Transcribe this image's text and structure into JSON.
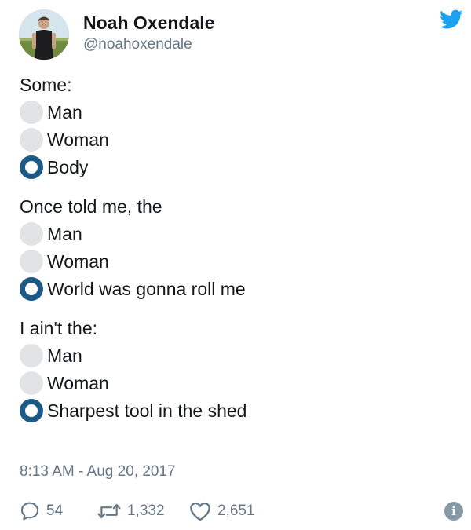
{
  "author": {
    "display_name": "Noah Oxendale",
    "handle": "@noahoxendale"
  },
  "icons": {
    "avatar": "profile-photo",
    "brand": "twitter-bird-icon",
    "reply": "speech-bubble-icon",
    "retweet": "retweet-arrows-icon",
    "like": "heart-icon",
    "info": "info-icon"
  },
  "colors": {
    "brand": "#1da1f2",
    "radio_checked": "#1b5a87",
    "radio_unchecked": "#e1e3e5",
    "secondary_text": "#657786"
  },
  "tweet": {
    "stanzas": [
      {
        "intro": "Some:",
        "options": [
          {
            "label": "Man",
            "checked": false
          },
          {
            "label": "Woman",
            "checked": false
          },
          {
            "label": "Body",
            "checked": true
          }
        ]
      },
      {
        "intro": "Once told me, the",
        "options": [
          {
            "label": "Man",
            "checked": false
          },
          {
            "label": "Woman",
            "checked": false
          },
          {
            "label": "World was gonna roll me",
            "checked": true
          }
        ]
      },
      {
        "intro": "I ain't the:",
        "options": [
          {
            "label": "Man",
            "checked": false
          },
          {
            "label": "Woman",
            "checked": false
          },
          {
            "label": "Sharpest tool in the shed",
            "checked": true
          }
        ]
      }
    ],
    "timestamp": "8:13 AM - Aug 20, 2017"
  },
  "stats": {
    "replies": "54",
    "retweets": "1,332",
    "likes": "2,651"
  }
}
